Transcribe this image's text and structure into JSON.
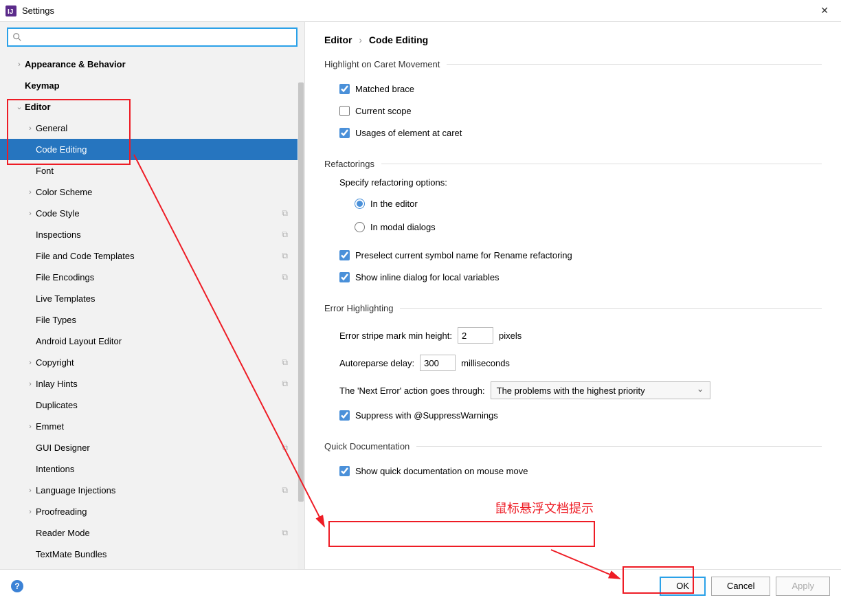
{
  "window": {
    "title": "Settings"
  },
  "sidebar": {
    "items": [
      {
        "label": "Appearance & Behavior",
        "arrow": "right",
        "bold": true,
        "level": 0
      },
      {
        "label": "Keymap",
        "arrow": "",
        "bold": true,
        "level": 0
      },
      {
        "label": "Editor",
        "arrow": "down",
        "bold": true,
        "level": 0
      },
      {
        "label": "General",
        "arrow": "right",
        "bold": false,
        "level": 1
      },
      {
        "label": "Code Editing",
        "arrow": "",
        "bold": false,
        "level": 1,
        "selected": true
      },
      {
        "label": "Font",
        "arrow": "",
        "bold": false,
        "level": 1
      },
      {
        "label": "Color Scheme",
        "arrow": "right",
        "bold": false,
        "level": 1
      },
      {
        "label": "Code Style",
        "arrow": "right",
        "bold": false,
        "level": 1,
        "copy": true
      },
      {
        "label": "Inspections",
        "arrow": "",
        "bold": false,
        "level": 1,
        "copy": true
      },
      {
        "label": "File and Code Templates",
        "arrow": "",
        "bold": false,
        "level": 1,
        "copy": true
      },
      {
        "label": "File Encodings",
        "arrow": "",
        "bold": false,
        "level": 1,
        "copy": true
      },
      {
        "label": "Live Templates",
        "arrow": "",
        "bold": false,
        "level": 1
      },
      {
        "label": "File Types",
        "arrow": "",
        "bold": false,
        "level": 1
      },
      {
        "label": "Android Layout Editor",
        "arrow": "",
        "bold": false,
        "level": 1
      },
      {
        "label": "Copyright",
        "arrow": "right",
        "bold": false,
        "level": 1,
        "copy": true
      },
      {
        "label": "Inlay Hints",
        "arrow": "right",
        "bold": false,
        "level": 1,
        "copy": true
      },
      {
        "label": "Duplicates",
        "arrow": "",
        "bold": false,
        "level": 1
      },
      {
        "label": "Emmet",
        "arrow": "right",
        "bold": false,
        "level": 1
      },
      {
        "label": "GUI Designer",
        "arrow": "",
        "bold": false,
        "level": 1,
        "copy": true
      },
      {
        "label": "Intentions",
        "arrow": "",
        "bold": false,
        "level": 1
      },
      {
        "label": "Language Injections",
        "arrow": "right",
        "bold": false,
        "level": 1,
        "copy": true
      },
      {
        "label": "Proofreading",
        "arrow": "right",
        "bold": false,
        "level": 1
      },
      {
        "label": "Reader Mode",
        "arrow": "",
        "bold": false,
        "level": 1,
        "copy": true
      },
      {
        "label": "TextMate Bundles",
        "arrow": "",
        "bold": false,
        "level": 1
      }
    ]
  },
  "breadcrumb": {
    "parent": "Editor",
    "sep": "›",
    "current": "Code Editing"
  },
  "sections": {
    "highlight": {
      "title": "Highlight on Caret Movement",
      "matched": "Matched brace",
      "scope": "Current scope",
      "usages": "Usages of element at caret"
    },
    "refactor": {
      "title": "Refactorings",
      "specify": "Specify refactoring options:",
      "ineditor": "In the editor",
      "inmodal": "In modal dialogs",
      "preselect": "Preselect current symbol name for Rename refactoring",
      "inline": "Show inline dialog for local variables"
    },
    "error": {
      "title": "Error Highlighting",
      "stripe_label": "Error stripe mark min height:",
      "stripe_value": "2",
      "stripe_unit": "pixels",
      "delay_label": "Autoreparse delay:",
      "delay_value": "300",
      "delay_unit": "milliseconds",
      "next_label": "The 'Next Error' action goes through:",
      "next_select": "The problems with the highest priority",
      "suppress": "Suppress with @SuppressWarnings"
    },
    "quickdoc": {
      "title": "Quick Documentation",
      "show": "Show quick documentation on mouse move"
    }
  },
  "footer": {
    "ok": "OK",
    "cancel": "Cancel",
    "apply": "Apply"
  },
  "annotation": {
    "tip": "鼠标悬浮文档提示"
  }
}
